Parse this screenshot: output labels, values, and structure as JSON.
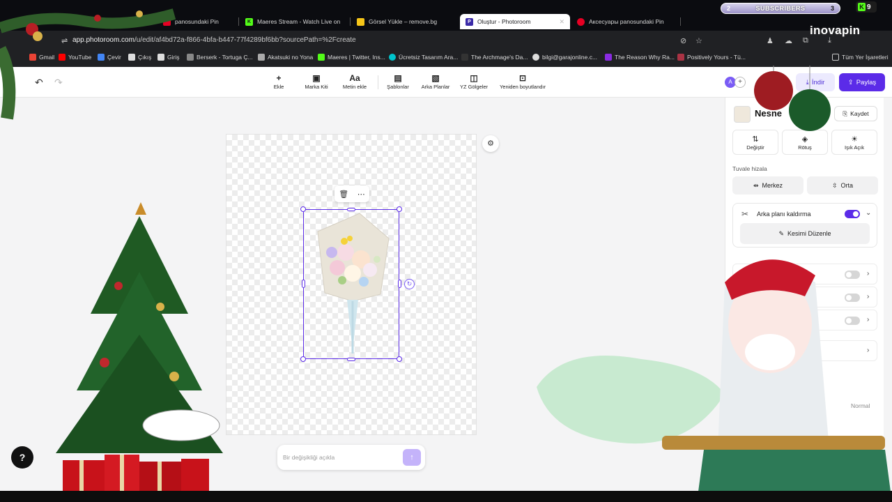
{
  "browser": {
    "tabs": [
      {
        "label": "panosundaki Pin",
        "favicon_color": "#e60023"
      },
      {
        "label": "Maeres Stream - Watch Live on",
        "favicon_color": "#53fc18",
        "favicon_text": "K"
      },
      {
        "label": "Görsel Yükle – remove.bg",
        "favicon_color": "#f5c518"
      },
      {
        "label": "Oluştur - Photoroom",
        "favicon_color": "#3b2aa8",
        "active": true
      },
      {
        "label": "Aкcecyapы panosundaki Pin",
        "favicon_color": "#e60023"
      }
    ],
    "url_domain": "app.photoroom.com",
    "url_path": "/u/edit/af4bd72a-f866-4bfa-b447-77f4289bf6bb?sourcePath=%2Fcreate",
    "bookmarks": [
      {
        "label": "Gmail",
        "color": "#ea4335"
      },
      {
        "label": "YouTube",
        "color": "#ff0000"
      },
      {
        "label": "Çevir",
        "color": "#4285f4"
      },
      {
        "label": "Çıkış",
        "color": "#dddddd"
      },
      {
        "label": "Giriş",
        "color": "#dddddd"
      },
      {
        "label": "Berserk - Tortuga Ç...",
        "color": "#888888"
      },
      {
        "label": "Akatsuki no Yona",
        "color": "#aaaaaa"
      },
      {
        "label": "Maeres | Twitter, Ins...",
        "color": "#53fc18"
      },
      {
        "label": "Ücretsiz Tasarım Ara...",
        "color": "#00c4cc"
      },
      {
        "label": "The Archmage's Da...",
        "color": "#333333"
      },
      {
        "label": "bilgi@garajonline.c...",
        "color": "#dddddd"
      },
      {
        "label": "The Reason Why Ra...",
        "color": "#8a2be2"
      },
      {
        "label": "Positively Yours - Tü...",
        "color": "#aa3344"
      },
      {
        "label": "Tüm Yer İşaretleri",
        "color": "#dddddd"
      }
    ]
  },
  "toolbar": {
    "items": [
      {
        "label": "Ekle",
        "icon": "plus-icon",
        "glyph": "+"
      },
      {
        "label": "Marka Kiti",
        "icon": "brand-kit-icon",
        "glyph": "▣"
      },
      {
        "label": "Metin ekle",
        "icon": "text-icon",
        "glyph": "Aa"
      },
      {
        "label": "Şablonlar",
        "icon": "templates-icon",
        "glyph": "▤"
      },
      {
        "label": "Arka Planlar",
        "icon": "backgrounds-icon",
        "glyph": "▧"
      },
      {
        "label": "YZ Gölgeler",
        "icon": "ai-shadows-icon",
        "glyph": "◫"
      },
      {
        "label": "Yeniden boyutlandır",
        "icon": "resize-icon",
        "glyph": "⊡"
      }
    ],
    "avatar_letter": "A",
    "download_label": "İndir",
    "share_label": "Paylaş"
  },
  "editor": {
    "prompt_placeholder": "Bir değişikliği açıkla"
  },
  "panel": {
    "title": "Nesne",
    "save_label": "Kaydet",
    "actions": [
      {
        "label": "Değiştir",
        "glyph": "⇅"
      },
      {
        "label": "Rötuş",
        "glyph": "◈"
      },
      {
        "label": "Işık Açık",
        "glyph": "☀"
      }
    ],
    "align_label": "Tuvale hizala",
    "align_buttons": [
      {
        "label": "Merkez",
        "glyph": "⇹"
      },
      {
        "label": "Orta",
        "glyph": "⇳"
      }
    ],
    "bg_removal_label": "Arka planı kaldırma",
    "bg_removal_on": true,
    "edit_cut_label": "Kesimi Düzenle",
    "blend_mode_value": "Normal"
  },
  "overlay": {
    "subscribers_label": "SUBSCRIBERS",
    "subscribers_left": "2",
    "subscribers_right": "3",
    "kick_count": "9",
    "watermark": "inovapin"
  }
}
